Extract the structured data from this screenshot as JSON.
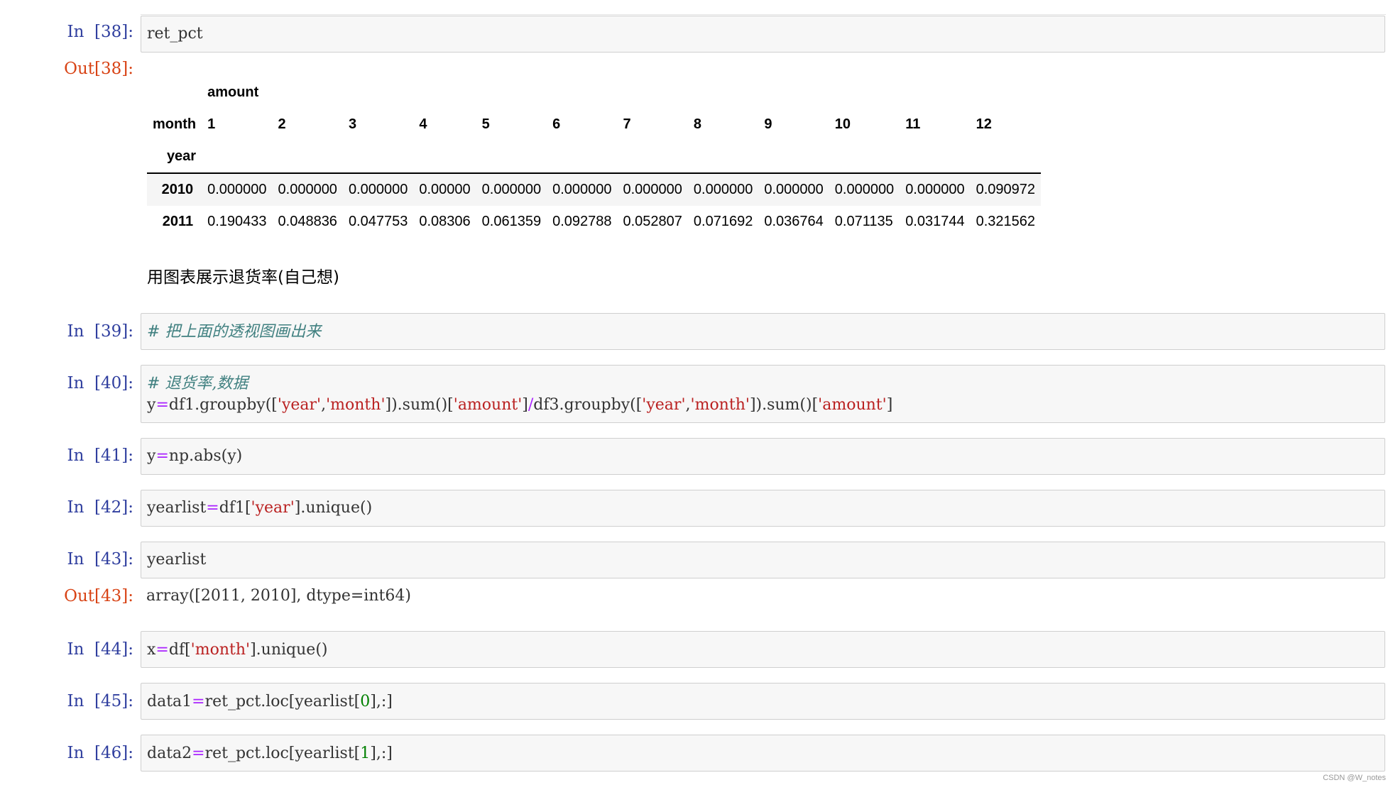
{
  "cells": {
    "c38": {
      "in": "In  [38]:",
      "out": "Out[38]:",
      "code": "ret_pct"
    },
    "c39": {
      "in": "In  [39]:",
      "comment": "# 把上面的透视图画出来"
    },
    "c40": {
      "in": "In  [40]:",
      "comment": "# 退货率,数据"
    },
    "c41": {
      "in": "In  [41]:"
    },
    "c42": {
      "in": "In  [42]:"
    },
    "c43": {
      "in": "In  [43]:",
      "out": "Out[43]:",
      "code": "yearlist",
      "output": "array([2011, 2010], dtype=int64)"
    },
    "c44": {
      "in": "In  [44]:"
    },
    "c45": {
      "in": "In  [45]:"
    },
    "c46": {
      "in": "In  [46]:"
    }
  },
  "tokens": {
    "y": "y",
    "eq": "=",
    "df1_groupby": "df1.groupby([",
    "q": "'",
    "year": "year",
    "comma": ",",
    "month": "month",
    "sum_open": "]).sum()[",
    "amount": "amount",
    "close": "]",
    "div": "/",
    "df3_groupby": "df3.groupby([",
    "np_abs": "np.abs(y)",
    "yearlist": "yearlist",
    "df1_open": "df1[",
    "unique": "].unique()",
    "x": "x",
    "df_open": "df[",
    "data1": "data1",
    "data2": "data2",
    "ret_loc": "ret_pct.loc[yearlist[",
    "zero": "0",
    "one": "1",
    "slice_end": "],:]"
  },
  "markdown": {
    "text": "用图表展示退货率(自己想)"
  },
  "table": {
    "top_header": "amount",
    "columns_label": "month",
    "index_label": "year",
    "columns": [
      "1",
      "2",
      "3",
      "4",
      "5",
      "6",
      "7",
      "8",
      "9",
      "10",
      "11",
      "12"
    ],
    "rows": [
      {
        "index": "2010",
        "values": [
          "0.000000",
          "0.000000",
          "0.000000",
          "0.00000",
          "0.000000",
          "0.000000",
          "0.000000",
          "0.000000",
          "0.000000",
          "0.000000",
          "0.000000",
          "0.090972"
        ]
      },
      {
        "index": "2011",
        "values": [
          "0.190433",
          "0.048836",
          "0.047753",
          "0.08306",
          "0.061359",
          "0.092788",
          "0.052807",
          "0.071692",
          "0.036764",
          "0.071135",
          "0.031744",
          "0.321562"
        ]
      }
    ]
  },
  "watermark": "CSDN @W_notes",
  "colors": {
    "in_prompt": "#303f9f",
    "out_prompt": "#d84315",
    "string": "#ba2121",
    "operator": "#aa22ff",
    "number": "#008000",
    "comment": "#408080"
  }
}
